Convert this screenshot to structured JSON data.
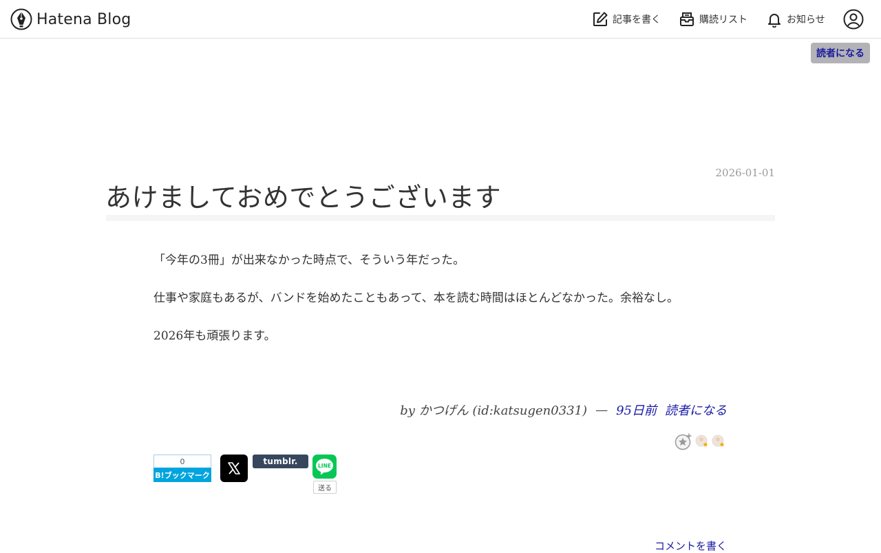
{
  "header": {
    "brand": "Hatena Blog",
    "write_label": "記事を書く",
    "subscriptions_label": "購読リスト",
    "notifications_label": "お知らせ",
    "subscribe_label": "読者になる"
  },
  "entry": {
    "date": "2026-01-01",
    "title": "あけましておめでとうございます",
    "paragraphs": [
      "「今年の3冊」が出来なかった時点で、そういう年だった。",
      "仕事や家庭もあるが、バンドを始めたこともあって、本を読む時間はほとんどなかった。余裕なし。",
      "2026年も頑張ります。"
    ],
    "author_line": "by かつげん (id:katsugen0331)",
    "separator": "—",
    "relative_time": "95日前",
    "subscribe_link": "読者になる"
  },
  "share": {
    "bookmark_count": "0",
    "bookmark_label": "B!ブックマーク",
    "tumblr_label": "tumblr.",
    "line_label": "LINE",
    "line_send": "送る"
  },
  "comment_link": "コメントを書く",
  "colors": {
    "link": "#1a1aa6",
    "hatena_blue": "#00a4de",
    "line_green": "#06c755",
    "tumblr": "#36465d"
  },
  "icons": [
    "pen-nib-logo-icon",
    "edit-icon",
    "subscriptions-icon",
    "bell-icon",
    "user-circle-icon",
    "add-star-icon",
    "star-user-icon",
    "x-logo-icon",
    "line-logo-icon"
  ]
}
